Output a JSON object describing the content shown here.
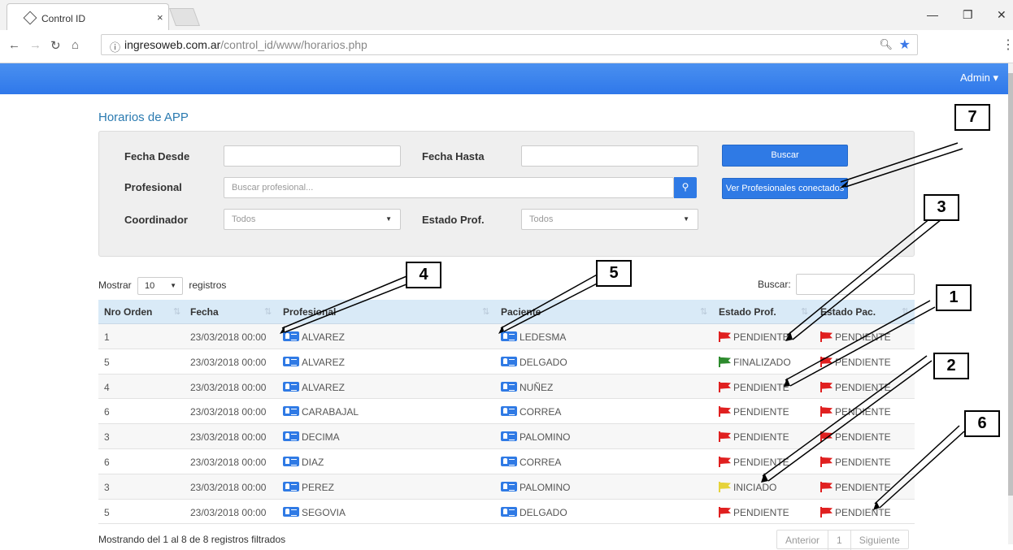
{
  "browser": {
    "tab_title": "Control ID",
    "tab_close": "×",
    "url_host": "ingresoweb.com.ar",
    "url_path": "/control_id/www/horarios.php",
    "info_icon": "ⓘ",
    "icons": [
      "back-icon",
      "forward-icon",
      "reload-icon",
      "home-icon",
      "zoom-icon",
      "star-icon",
      "menu-icon"
    ]
  },
  "navbar": {
    "user": "Admin ▾",
    "accent": "#2f78ea"
  },
  "page": {
    "title": "Horarios de APP"
  },
  "filters": {
    "fecha_desde_label": "Fecha Desde",
    "fecha_hasta_label": "Fecha Hasta",
    "buscar_button": "Buscar",
    "profesional_label": "Profesional",
    "profesional_placeholder": "Buscar profesional...",
    "ver_profesionales_button": "Ver Profesionales conectados",
    "coordinador_label": "Coordinador",
    "coordinador_value": "Todos",
    "estado_prof_label": "Estado Prof.",
    "estado_prof_value": "Todos"
  },
  "table_controls": {
    "mostrar": "Mostrar",
    "length": "10",
    "registros": "registros",
    "search_label": "Buscar:"
  },
  "table": {
    "headers": [
      "Nro Orden",
      "Fecha",
      "Profesional",
      "Paciente",
      "Estado Prof.",
      "Estado Pac."
    ],
    "rows": [
      {
        "nro": "1",
        "fecha": "23/03/2018 00:00",
        "profesional": "ALVAREZ",
        "paciente": "LEDESMA",
        "estado_prof": "PENDIENTE",
        "estado_prof_color": "#e02020",
        "estado_pac": "PENDIENTE",
        "estado_pac_color": "#e02020"
      },
      {
        "nro": "5",
        "fecha": "23/03/2018 00:00",
        "profesional": "ALVAREZ",
        "paciente": "DELGADO",
        "estado_prof": "FINALIZADO",
        "estado_prof_color": "#2e8b2e",
        "estado_pac": "PENDIENTE",
        "estado_pac_color": "#e02020"
      },
      {
        "nro": "4",
        "fecha": "23/03/2018 00:00",
        "profesional": "ALVAREZ",
        "paciente": "NUÑEZ",
        "estado_prof": "PENDIENTE",
        "estado_prof_color": "#e02020",
        "estado_pac": "PENDIENTE",
        "estado_pac_color": "#e02020"
      },
      {
        "nro": "6",
        "fecha": "23/03/2018 00:00",
        "profesional": "CARABAJAL",
        "paciente": "CORREA",
        "estado_prof": "PENDIENTE",
        "estado_prof_color": "#e02020",
        "estado_pac": "PENDIENTE",
        "estado_pac_color": "#e02020"
      },
      {
        "nro": "3",
        "fecha": "23/03/2018 00:00",
        "profesional": "DECIMA",
        "paciente": "PALOMINO",
        "estado_prof": "PENDIENTE",
        "estado_prof_color": "#e02020",
        "estado_pac": "PENDIENTE",
        "estado_pac_color": "#e02020"
      },
      {
        "nro": "6",
        "fecha": "23/03/2018 00:00",
        "profesional": "DIAZ",
        "paciente": "CORREA",
        "estado_prof": "PENDIENTE",
        "estado_prof_color": "#e02020",
        "estado_pac": "PENDIENTE",
        "estado_pac_color": "#e02020"
      },
      {
        "nro": "3",
        "fecha": "23/03/2018 00:00",
        "profesional": "PEREZ",
        "paciente": "PALOMINO",
        "estado_prof": "INICIADO",
        "estado_prof_color": "#e6d33a",
        "estado_pac": "PENDIENTE",
        "estado_pac_color": "#e02020"
      },
      {
        "nro": "5",
        "fecha": "23/03/2018 00:00",
        "profesional": "SEGOVIA",
        "paciente": "DELGADO",
        "estado_prof": "PENDIENTE",
        "estado_prof_color": "#e02020",
        "estado_pac": "PENDIENTE",
        "estado_pac_color": "#e02020"
      }
    ]
  },
  "footer": {
    "info": "Mostrando del 1 al 8 de 8 registros filtrados",
    "prev": "Anterior",
    "page": "1",
    "next": "Siguiente"
  },
  "callouts": [
    "1",
    "2",
    "3",
    "4",
    "5",
    "6",
    "7"
  ]
}
